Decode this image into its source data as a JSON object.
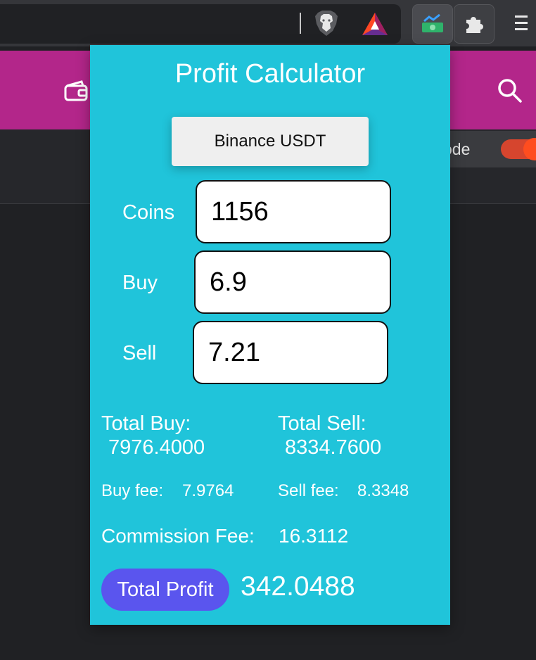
{
  "browser": {
    "extensions": {
      "brave_shields_icon": "lion-shield-icon",
      "bat_rewards_icon": "bat-triangle-icon",
      "calculator_ext_icon": "money-chart-icon",
      "extensions_icon": "puzzle-icon",
      "menu_icon": "hamburger-menu-icon"
    }
  },
  "page": {
    "mode_label": "ode",
    "accent_color": "#b3268a"
  },
  "popup": {
    "title": "Profit Calculator",
    "exchange_button": "Binance USDT",
    "fields": [
      {
        "label": "Coins",
        "value": "1156"
      },
      {
        "label": "Buy",
        "value": "6.9"
      },
      {
        "label": "Sell",
        "value": "7.21"
      }
    ],
    "results": {
      "total_buy_label": "Total Buy:",
      "total_buy_value": "7976.4000",
      "total_sell_label": "Total Sell:",
      "total_sell_value": "8334.7600",
      "buy_fee_label": "Buy fee:",
      "buy_fee_value": "7.9764",
      "sell_fee_label": "Sell fee:",
      "sell_fee_value": "8.3348",
      "commission_label": "Commission Fee:",
      "commission_value": "16.3112",
      "total_profit_label": "Total Profit",
      "total_profit_value": "342.0488"
    },
    "colors": {
      "background": "#20c4da",
      "profit_pill": "#5a55ee"
    }
  }
}
